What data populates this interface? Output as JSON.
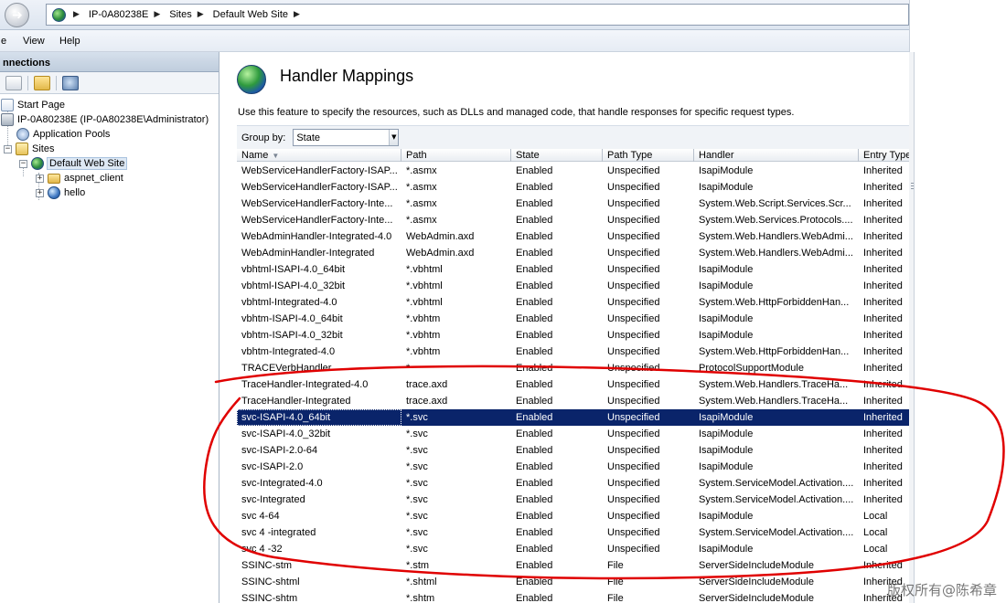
{
  "breadcrumb": [
    "IP-0A80238E",
    "Sites",
    "Default Web Site"
  ],
  "menu": [
    "e",
    "View",
    "Help"
  ],
  "connections": {
    "title": "nnections",
    "tree": [
      {
        "label": "Start Page",
        "icon": "start-page-icon"
      },
      {
        "label": "IP-0A80238E (IP-0A80238E\\Administrator)",
        "icon": "server-icon"
      },
      {
        "label": "Application Pools",
        "icon": "app-pools-icon"
      },
      {
        "label": "Sites",
        "icon": "sites-icon"
      },
      {
        "label": "Default Web Site",
        "icon": "globe-icon"
      },
      {
        "label": "aspnet_client",
        "icon": "folder-icon"
      },
      {
        "label": "hello",
        "icon": "application-icon"
      }
    ]
  },
  "feature": {
    "title": "Handler Mappings",
    "description": "Use this feature to specify the resources, such as DLLs and managed code, that handle responses for specific request types.",
    "group_by_label": "Group by:",
    "group_by_value": "State"
  },
  "table": {
    "columns": [
      "Name",
      "Path",
      "State",
      "Path Type",
      "Handler",
      "Entry Type"
    ],
    "rows": [
      [
        "WebServiceHandlerFactory-ISAP...",
        "*.asmx",
        "Enabled",
        "Unspecified",
        "IsapiModule",
        "Inherited"
      ],
      [
        "WebServiceHandlerFactory-ISAP...",
        "*.asmx",
        "Enabled",
        "Unspecified",
        "IsapiModule",
        "Inherited"
      ],
      [
        "WebServiceHandlerFactory-Inte...",
        "*.asmx",
        "Enabled",
        "Unspecified",
        "System.Web.Script.Services.Scr...",
        "Inherited"
      ],
      [
        "WebServiceHandlerFactory-Inte...",
        "*.asmx",
        "Enabled",
        "Unspecified",
        "System.Web.Services.Protocols....",
        "Inherited"
      ],
      [
        "WebAdminHandler-Integrated-4.0",
        "WebAdmin.axd",
        "Enabled",
        "Unspecified",
        "System.Web.Handlers.WebAdmi...",
        "Inherited"
      ],
      [
        "WebAdminHandler-Integrated",
        "WebAdmin.axd",
        "Enabled",
        "Unspecified",
        "System.Web.Handlers.WebAdmi...",
        "Inherited"
      ],
      [
        "vbhtml-ISAPI-4.0_64bit",
        "*.vbhtml",
        "Enabled",
        "Unspecified",
        "IsapiModule",
        "Inherited"
      ],
      [
        "vbhtml-ISAPI-4.0_32bit",
        "*.vbhtml",
        "Enabled",
        "Unspecified",
        "IsapiModule",
        "Inherited"
      ],
      [
        "vbhtml-Integrated-4.0",
        "*.vbhtml",
        "Enabled",
        "Unspecified",
        "System.Web.HttpForbiddenHan...",
        "Inherited"
      ],
      [
        "vbhtm-ISAPI-4.0_64bit",
        "*.vbhtm",
        "Enabled",
        "Unspecified",
        "IsapiModule",
        "Inherited"
      ],
      [
        "vbhtm-ISAPI-4.0_32bit",
        "*.vbhtm",
        "Enabled",
        "Unspecified",
        "IsapiModule",
        "Inherited"
      ],
      [
        "vbhtm-Integrated-4.0",
        "*.vbhtm",
        "Enabled",
        "Unspecified",
        "System.Web.HttpForbiddenHan...",
        "Inherited"
      ],
      [
        "TRACEVerbHandler",
        "*",
        "Enabled",
        "Unspecified",
        "ProtocolSupportModule",
        "Inherited"
      ],
      [
        "TraceHandler-Integrated-4.0",
        "trace.axd",
        "Enabled",
        "Unspecified",
        "System.Web.Handlers.TraceHa...",
        "Inherited"
      ],
      [
        "TraceHandler-Integrated",
        "trace.axd",
        "Enabled",
        "Unspecified",
        "System.Web.Handlers.TraceHa...",
        "Inherited"
      ],
      [
        "svc-ISAPI-4.0_64bit",
        "*.svc",
        "Enabled",
        "Unspecified",
        "IsapiModule",
        "Inherited"
      ],
      [
        "svc-ISAPI-4.0_32bit",
        "*.svc",
        "Enabled",
        "Unspecified",
        "IsapiModule",
        "Inherited"
      ],
      [
        "svc-ISAPI-2.0-64",
        "*.svc",
        "Enabled",
        "Unspecified",
        "IsapiModule",
        "Inherited"
      ],
      [
        "svc-ISAPI-2.0",
        "*.svc",
        "Enabled",
        "Unspecified",
        "IsapiModule",
        "Inherited"
      ],
      [
        "svc-Integrated-4.0",
        "*.svc",
        "Enabled",
        "Unspecified",
        "System.ServiceModel.Activation....",
        "Inherited"
      ],
      [
        "svc-Integrated",
        "*.svc",
        "Enabled",
        "Unspecified",
        "System.ServiceModel.Activation....",
        "Inherited"
      ],
      [
        "svc 4-64",
        "*.svc",
        "Enabled",
        "Unspecified",
        "IsapiModule",
        "Local"
      ],
      [
        "svc 4 -integrated",
        "*.svc",
        "Enabled",
        "Unspecified",
        "System.ServiceModel.Activation....",
        "Local"
      ],
      [
        "svc 4 -32",
        "*.svc",
        "Enabled",
        "Unspecified",
        "IsapiModule",
        "Local"
      ],
      [
        "SSINC-stm",
        "*.stm",
        "Enabled",
        "File",
        "ServerSideIncludeModule",
        "Inherited"
      ],
      [
        "SSINC-shtml",
        "*.shtml",
        "Enabled",
        "File",
        "ServerSideIncludeModule",
        "Inherited"
      ],
      [
        "SSINC-shtm",
        "*.shtm",
        "Enabled",
        "File",
        "ServerSideIncludeModule",
        "Inherited"
      ]
    ],
    "selected_row": 15
  },
  "watermark": "版权所有@陈希章",
  "colors": {
    "selection": "#0a246a",
    "annotation": "#e00000"
  }
}
